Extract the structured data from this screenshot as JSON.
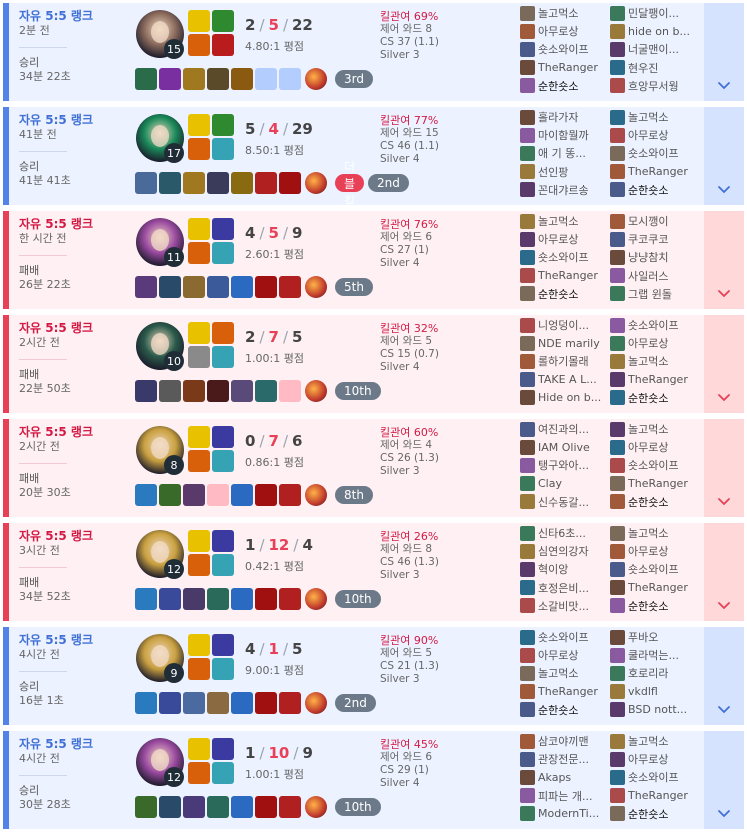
{
  "colors": {
    "win_accent": "#5383e8",
    "loss_accent": "#e84057",
    "win_bg": "#ecf2ff",
    "loss_bg": "#fff1f3"
  },
  "matches": [
    {
      "result_type": "win",
      "queue": "자유 5:5 랭크",
      "time_ago": "2분 전",
      "result": "승리",
      "duration": "34분 22초",
      "champion_icon": "champion-portrait-icon",
      "champ_color": "#8a6a5c",
      "level": "15",
      "kills": "2",
      "deaths": "5",
      "assists": "22",
      "kda_ratio": "4.80:1 평점",
      "spell_colors": [
        "#e8c100",
        "#2f8a2f",
        "#d9600b",
        "#b81c1c"
      ],
      "item_colors": [
        "#2a6b4a",
        "#7a2fa0",
        "#a07820",
        "#5a4a2a",
        "#8a5a10",
        null,
        null
      ],
      "ward_color": "#c0392b",
      "multikill": "",
      "placement": "3rd",
      "kill_participation": "킬관여 69%",
      "control_wards": "제어 와드 8",
      "cs": "CS 37 (1.1)",
      "tier": "Silver 3",
      "team1": [
        "놀고먹소",
        "아무로상",
        "숏소와이프",
        "TheRanger",
        "순한숏소"
      ],
      "team2": [
        "민달팽이...",
        "hide on b...",
        "너굴맨이...",
        "현우진",
        "흐앙무서웡"
      ],
      "me": [
        0,
        4
      ]
    },
    {
      "result_type": "win",
      "queue": "자유 5:5 랭크",
      "time_ago": "41분 전",
      "result": "승리",
      "duration": "41분 41초",
      "champion_icon": "champion-portrait-icon",
      "champ_color": "#1a8a5a",
      "level": "17",
      "kills": "5",
      "deaths": "4",
      "assists": "29",
      "kda_ratio": "8.50:1 평점",
      "spell_colors": [
        "#e8c100",
        "#2f8a2f",
        "#d9600b",
        "#36a3b5"
      ],
      "item_colors": [
        "#4a6a9a",
        "#2a5a6a",
        "#a07820",
        "#3a3a5a",
        "#8a6a10",
        "#b02020",
        "#a01010"
      ],
      "ward_color": "#c0392b",
      "multikill": "더블킬",
      "placement": "2nd",
      "kill_participation": "킬관여 77%",
      "control_wards": "제어 와드 15",
      "cs": "CS 46 (1.1)",
      "tier": "Silver 4",
      "team1": [
        "홀라가자",
        "마이함뭘까",
        "애 기 똥...",
        "선인팡",
        "꼰대갸르송"
      ],
      "team2": [
        "놀고먹소",
        "아무로상",
        "숏소와이프",
        "TheRanger",
        "순한숏소"
      ],
      "me": [
        1,
        4
      ]
    },
    {
      "result_type": "loss",
      "queue": "자유 5:5 랭크",
      "time_ago": "한 시간 전",
      "result": "패배",
      "duration": "26분 22초",
      "champion_icon": "champion-portrait-icon",
      "champ_color": "#9a4aa0",
      "level": "11",
      "kills": "4",
      "deaths": "5",
      "assists": "9",
      "kda_ratio": "2.60:1 평점",
      "spell_colors": [
        "#e8c100",
        "#3a3aa0",
        "#d9600b",
        "#36a3b5"
      ],
      "item_colors": [
        "#5a3a7a",
        "#2a4a6a",
        "#8a6a30",
        "#3a5a9a",
        "#2a6ac0",
        "#a01010",
        "#b02020"
      ],
      "ward_color": "#c0392b",
      "multikill": "",
      "placement": "5th",
      "kill_participation": "킬관여 76%",
      "control_wards": "제어 와드 6",
      "cs": "CS 27 (1)",
      "tier": "Silver 4",
      "team1": [
        "놀고먹소",
        "아무로상",
        "숏소와이프",
        "TheRanger",
        "순한숏소"
      ],
      "team2": [
        "모시깽이",
        "쿠코쿠코",
        "냥냥참치",
        "사일러스",
        "그랩 윈돌"
      ],
      "me": [
        0,
        4
      ]
    },
    {
      "result_type": "loss",
      "queue": "자유 5:5 랭크",
      "time_ago": "2시간 전",
      "result": "패배",
      "duration": "22분 50초",
      "champion_icon": "champion-portrait-icon",
      "champ_color": "#2a5a4a",
      "level": "10",
      "kills": "2",
      "deaths": "7",
      "assists": "5",
      "kda_ratio": "1.00:1 평점",
      "spell_colors": [
        "#e8c100",
        "#d9600b",
        "#8a8a8a",
        "#36a3b5"
      ],
      "item_colors": [
        "#3a3a6a",
        "#5a5a5a",
        "#7a3a1a",
        "#4a1a1a",
        "#5a4a7a",
        "#2a6a6a",
        null
      ],
      "ward_color": "#c0392b",
      "multikill": "",
      "placement": "10th",
      "kill_participation": "킬관여 32%",
      "control_wards": "제어 와드 5",
      "cs": "CS 15 (0.7)",
      "tier": "Silver 4",
      "team1": [
        "니엉덩이...",
        "NDE marily",
        "롤하기몰래",
        "TAKE A L...",
        "Hide on b..."
      ],
      "team2": [
        "숏소와이프",
        "아무로상",
        "놀고먹소",
        "TheRanger",
        "순한숏소"
      ],
      "me": [
        1,
        4
      ]
    },
    {
      "result_type": "loss",
      "queue": "자유 5:5 랭크",
      "time_ago": "2시간 전",
      "result": "패배",
      "duration": "20분 30초",
      "champion_icon": "champion-portrait-icon",
      "champ_color": "#c9a040",
      "level": "8",
      "kills": "0",
      "deaths": "7",
      "assists": "6",
      "kda_ratio": "0.86:1 평점",
      "spell_colors": [
        "#e8c100",
        "#3a3aa0",
        "#d9600b",
        "#36a3b5"
      ],
      "item_colors": [
        "#2a7ac0",
        "#3a6a2a",
        "#5a3a6a",
        null,
        "#2a6ac0",
        "#a01010",
        "#b02020"
      ],
      "ward_color": "#c0392b",
      "multikill": "",
      "placement": "8th",
      "kill_participation": "킬관여 60%",
      "control_wards": "제어 와드 4",
      "cs": "CS 26 (1.3)",
      "tier": "Silver 3",
      "team1": [
        "여진과의...",
        "IAM Olive",
        "탱구와아...",
        "Clay",
        "신수동갈..."
      ],
      "team2": [
        "놀고먹소",
        "아무로상",
        "숏소와이프",
        "TheRanger",
        "순한숏소"
      ],
      "me": [
        1,
        4
      ]
    },
    {
      "result_type": "loss",
      "queue": "자유 5:5 랭크",
      "time_ago": "3시간 전",
      "result": "패배",
      "duration": "34분 52초",
      "champion_icon": "champion-portrait-icon",
      "champ_color": "#c9a040",
      "level": "12",
      "kills": "1",
      "deaths": "12",
      "assists": "4",
      "kda_ratio": "0.42:1 평점",
      "spell_colors": [
        "#e8c100",
        "#3a3aa0",
        "#d9600b",
        "#36a3b5"
      ],
      "item_colors": [
        "#2a7ac0",
        "#3a4a9a",
        "#4a3a6a",
        "#2a6a5a",
        "#2a6ac0",
        "#a01010",
        "#b02020"
      ],
      "ward_color": "#c0392b",
      "multikill": "",
      "placement": "10th",
      "kill_participation": "킬관여 26%",
      "control_wards": "제어 와드 8",
      "cs": "CS 46 (1.3)",
      "tier": "Silver 3",
      "team1": [
        "신타6초...",
        "심연의강자",
        "혁이앙",
        "호정은비...",
        "소갈비맛..."
      ],
      "team2": [
        "놀고먹소",
        "아무로상",
        "숏소와이프",
        "TheRanger",
        "순한숏소"
      ],
      "me": [
        1,
        4
      ]
    },
    {
      "result_type": "win",
      "queue": "자유 5:5 랭크",
      "time_ago": "4시간 전",
      "result": "승리",
      "duration": "16분 1초",
      "champion_icon": "champion-portrait-icon",
      "champ_color": "#c9a040",
      "level": "9",
      "kills": "4",
      "deaths": "1",
      "assists": "5",
      "kda_ratio": "9.00:1 평점",
      "spell_colors": [
        "#e8c100",
        "#3a3aa0",
        "#d9600b",
        "#36a3b5"
      ],
      "item_colors": [
        "#2a7ac0",
        "#3a4a9a",
        "#4a6aa0",
        "#8a6a40",
        "#2a6ac0",
        "#a01010",
        "#b02020"
      ],
      "ward_color": "#c0392b",
      "multikill": "",
      "placement": "2nd",
      "kill_participation": "킬관여 90%",
      "control_wards": "제어 와드 5",
      "cs": "CS 21 (1.3)",
      "tier": "Silver 3",
      "team1": [
        "숏소와이프",
        "아무로상",
        "놀고먹소",
        "TheRanger",
        "순한숏소"
      ],
      "team2": [
        "푸바오",
        "쿨라먹는...",
        "호로리라",
        "vkdlfl",
        "BSD nott..."
      ],
      "me": [
        0,
        4
      ]
    },
    {
      "result_type": "win",
      "queue": "자유 5:5 랭크",
      "time_ago": "4시간 전",
      "result": "승리",
      "duration": "30분 28초",
      "champion_icon": "champion-portrait-icon",
      "champ_color": "#9a4aa0",
      "level": "12",
      "kills": "1",
      "deaths": "10",
      "assists": "9",
      "kda_ratio": "1.00:1 평점",
      "spell_colors": [
        "#e8c100",
        "#3a3aa0",
        "#d9600b",
        "#36a3b5"
      ],
      "item_colors": [
        "#3a6a2a",
        "#2a4a6a",
        "#4a3a7a",
        "#2a6a5a",
        "#2a6ac0",
        "#a01010",
        "#b02020"
      ],
      "ward_color": "#c0392b",
      "multikill": "",
      "placement": "10th",
      "kill_participation": "킬관여 45%",
      "control_wards": "제어 와드 6",
      "cs": "CS 29 (1)",
      "tier": "Silver 4",
      "team1": [
        "삼코야끼맨",
        "관장전문...",
        "Akaps",
        "피파는 개...",
        "ModernTi..."
      ],
      "team2": [
        "놀고먹소",
        "아무로상",
        "숏소와이프",
        "TheRanger",
        "순한숏소"
      ],
      "me": [
        1,
        4
      ]
    }
  ]
}
